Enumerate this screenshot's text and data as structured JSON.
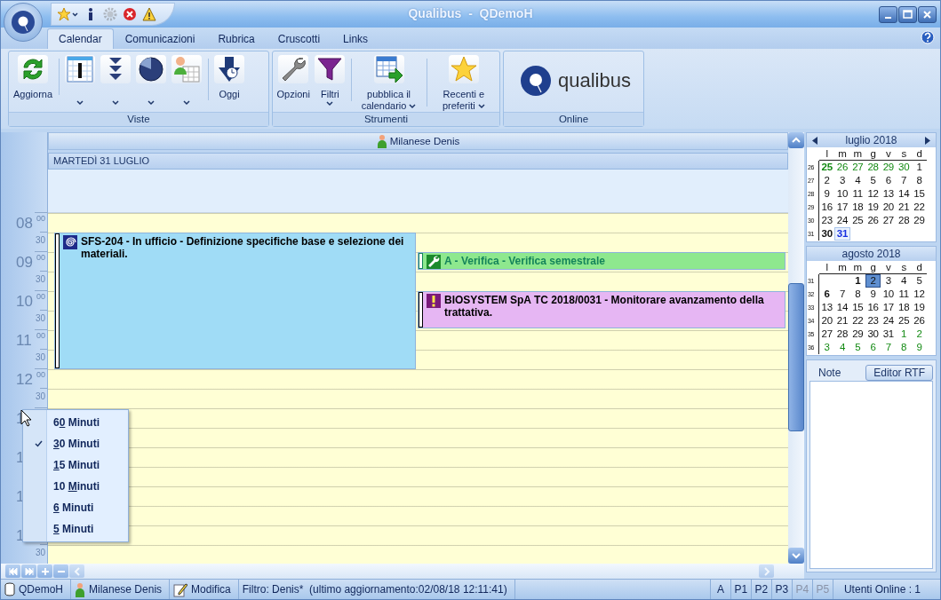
{
  "window": {
    "title": "Qualibus - QDemoH"
  },
  "quick_access": [
    {
      "kind": "star",
      "dropdown": true,
      "disabled": false
    },
    {
      "kind": "info",
      "dropdown": false,
      "disabled": false
    },
    {
      "kind": "gear",
      "dropdown": false,
      "disabled": true
    },
    {
      "kind": "close",
      "dropdown": false,
      "disabled": false
    },
    {
      "kind": "warning",
      "dropdown": false,
      "disabled": false
    }
  ],
  "tabs": [
    {
      "label": "Calendar",
      "selected": true
    },
    {
      "label": "Comunicazioni",
      "selected": false
    },
    {
      "label": "Rubrica",
      "selected": false
    },
    {
      "label": "Cruscotti",
      "selected": false
    },
    {
      "label": "Links",
      "selected": false
    }
  ],
  "ribbon_groups": [
    {
      "label": "Viste",
      "buttons": [
        {
          "kind": "refresh",
          "label": "Aggiorna",
          "dropdown": false,
          "divider_after": true
        },
        {
          "kind": "day-view",
          "dropdown": true,
          "divider_after": false
        },
        {
          "kind": "expand",
          "dropdown": true,
          "divider_after": false
        },
        {
          "kind": "pie",
          "dropdown": true,
          "divider_after": false
        },
        {
          "kind": "resource",
          "dropdown": true,
          "divider_after": true
        },
        {
          "kind": "today",
          "label": "Oggi",
          "dropdown": false,
          "divider_after": false
        }
      ]
    },
    {
      "label": "Strumenti",
      "buttons": [
        {
          "kind": "options",
          "label": "Opzioni",
          "dropdown": false,
          "divider_after": false
        },
        {
          "kind": "filter",
          "label": "Filtri",
          "dropdown": true,
          "divider_after": true
        },
        {
          "kind": "publish",
          "label": "pubblica il calendario",
          "dropdown": true,
          "divider_after": true
        },
        {
          "kind": "favorites",
          "label": "Recenti e preferiti",
          "dropdown": true,
          "divider_after": false
        }
      ]
    },
    {
      "label": "Online",
      "logo": "qualibus"
    }
  ],
  "calendar": {
    "resource": "Milanese Denis",
    "date": "MARTEDÌ 31 LUGLIO",
    "slots": [
      {
        "hour": "08",
        "minutes": "00",
        "half": "30"
      },
      {
        "hour": "09",
        "minutes": "00",
        "half": "30"
      },
      {
        "hour": "10",
        "minutes": "00",
        "half": "30"
      },
      {
        "hour": "11",
        "minutes": "00",
        "half": "30"
      },
      {
        "hour": "12",
        "minutes": "00",
        "half": "30"
      },
      {
        "hour": "1"
      },
      {
        "hour": "1"
      },
      {
        "hour": "1"
      },
      {
        "hour": "1",
        "half": "30"
      }
    ],
    "events": [
      {
        "kind": "task",
        "text": "SFS-204 - In ufficio - Definizione specifiche base e selezione dei materiali.",
        "color": "#a0dcf6"
      },
      {
        "kind": "maintenance",
        "text": "A - Verifica - Verifica semestrale",
        "color": "#8ee88e"
      },
      {
        "kind": "alert",
        "text": "BIOSYSTEM SpA TC 2018/0031 - Monitorare avanzamento della trattativa.",
        "color": "#e6b6f3"
      }
    ]
  },
  "slot_menu": {
    "items": [
      {
        "pre": "6",
        "key": "0",
        "post": " Minuti",
        "checked": false
      },
      {
        "key": "3",
        "post": "0 Minuti",
        "checked": true
      },
      {
        "key": "1",
        "post": "5 Minuti",
        "checked": false
      },
      {
        "pre": "10 ",
        "key": "M",
        "post": "inuti",
        "checked": false
      },
      {
        "key": "6",
        "post": " Minuti",
        "checked": false
      },
      {
        "key": "5",
        "post": " Minuti",
        "checked": false
      }
    ]
  },
  "months": [
    {
      "title": "luglio 2018",
      "arrows": true,
      "weekdays": [
        "l",
        "m",
        "m",
        "g",
        "v",
        "s",
        "d"
      ],
      "weeks": [
        {
          "number": "26",
          "days": [
            {
              "d": "25",
              "kind": "other-bold"
            },
            {
              "d": "26",
              "kind": "other"
            },
            {
              "d": "27",
              "kind": "other"
            },
            {
              "d": "28",
              "kind": "other"
            },
            {
              "d": "29",
              "kind": "other"
            },
            {
              "d": "30",
              "kind": "other"
            },
            {
              "d": "1",
              "kind": "normal"
            }
          ]
        },
        {
          "number": "27",
          "days": [
            {
              "d": "2",
              "kind": "normal"
            },
            {
              "d": "3",
              "kind": "normal"
            },
            {
              "d": "4",
              "kind": "normal"
            },
            {
              "d": "5",
              "kind": "normal"
            },
            {
              "d": "6",
              "kind": "normal"
            },
            {
              "d": "7",
              "kind": "normal"
            },
            {
              "d": "8",
              "kind": "normal"
            }
          ]
        },
        {
          "number": "28",
          "days": [
            {
              "d": "9",
              "kind": "normal"
            },
            {
              "d": "10",
              "kind": "normal"
            },
            {
              "d": "11",
              "kind": "normal"
            },
            {
              "d": "12",
              "kind": "normal"
            },
            {
              "d": "13",
              "kind": "normal"
            },
            {
              "d": "14",
              "kind": "normal"
            },
            {
              "d": "15",
              "kind": "normal"
            }
          ]
        },
        {
          "number": "29",
          "days": [
            {
              "d": "16",
              "kind": "normal"
            },
            {
              "d": "17",
              "kind": "normal"
            },
            {
              "d": "18",
              "kind": "normal"
            },
            {
              "d": "19",
              "kind": "normal"
            },
            {
              "d": "20",
              "kind": "normal"
            },
            {
              "d": "21",
              "kind": "normal"
            },
            {
              "d": "22",
              "kind": "normal"
            }
          ]
        },
        {
          "number": "30",
          "days": [
            {
              "d": "23",
              "kind": "normal"
            },
            {
              "d": "24",
              "kind": "normal"
            },
            {
              "d": "25",
              "kind": "normal"
            },
            {
              "d": "26",
              "kind": "normal"
            },
            {
              "d": "27",
              "kind": "normal"
            },
            {
              "d": "28",
              "kind": "normal"
            },
            {
              "d": "29",
              "kind": "normal"
            }
          ]
        },
        {
          "number": "31",
          "days": [
            {
              "d": "30",
              "kind": "bold"
            },
            {
              "d": "31",
              "kind": "today"
            },
            {
              "kind": "blank"
            },
            {
              "kind": "blank"
            },
            {
              "kind": "blank"
            },
            {
              "kind": "blank"
            },
            {
              "kind": "blank"
            }
          ]
        }
      ]
    },
    {
      "title": "agosto 2018",
      "arrows": false,
      "weekdays": [
        "l",
        "m",
        "m",
        "g",
        "v",
        "s",
        "d"
      ],
      "weeks": [
        {
          "number": "31",
          "days": [
            {
              "kind": "blank"
            },
            {
              "kind": "blank"
            },
            {
              "d": "1",
              "kind": "bold"
            },
            {
              "d": "2",
              "kind": "selected"
            },
            {
              "d": "3",
              "kind": "normal"
            },
            {
              "d": "4",
              "kind": "normal"
            },
            {
              "d": "5",
              "kind": "normal"
            }
          ]
        },
        {
          "number": "32",
          "days": [
            {
              "d": "6",
              "kind": "bold"
            },
            {
              "d": "7",
              "kind": "normal"
            },
            {
              "d": "8",
              "kind": "normal"
            },
            {
              "d": "9",
              "kind": "normal"
            },
            {
              "d": "10",
              "kind": "normal"
            },
            {
              "d": "11",
              "kind": "normal"
            },
            {
              "d": "12",
              "kind": "normal"
            }
          ]
        },
        {
          "number": "33",
          "days": [
            {
              "d": "13",
              "kind": "normal"
            },
            {
              "d": "14",
              "kind": "normal"
            },
            {
              "d": "15",
              "kind": "normal"
            },
            {
              "d": "16",
              "kind": "normal"
            },
            {
              "d": "17",
              "kind": "normal"
            },
            {
              "d": "18",
              "kind": "normal"
            },
            {
              "d": "19",
              "kind": "normal"
            }
          ]
        },
        {
          "number": "34",
          "days": [
            {
              "d": "20",
              "kind": "normal"
            },
            {
              "d": "21",
              "kind": "normal"
            },
            {
              "d": "22",
              "kind": "normal"
            },
            {
              "d": "23",
              "kind": "normal"
            },
            {
              "d": "24",
              "kind": "normal"
            },
            {
              "d": "25",
              "kind": "normal"
            },
            {
              "d": "26",
              "kind": "normal"
            }
          ]
        },
        {
          "number": "35",
          "days": [
            {
              "d": "27",
              "kind": "normal"
            },
            {
              "d": "28",
              "kind": "normal"
            },
            {
              "d": "29",
              "kind": "normal"
            },
            {
              "d": "30",
              "kind": "normal"
            },
            {
              "d": "31",
              "kind": "normal"
            },
            {
              "d": "1",
              "kind": "other"
            },
            {
              "d": "2",
              "kind": "other"
            }
          ]
        },
        {
          "number": "36",
          "days": [
            {
              "d": "3",
              "kind": "other"
            },
            {
              "d": "4",
              "kind": "other"
            },
            {
              "d": "5",
              "kind": "other"
            },
            {
              "d": "6",
              "kind": "other"
            },
            {
              "d": "7",
              "kind": "other"
            },
            {
              "d": "8",
              "kind": "other"
            },
            {
              "d": "9",
              "kind": "other"
            }
          ]
        }
      ]
    }
  ],
  "notes": {
    "tab": "Note",
    "button": "Editor RTF"
  },
  "status_bar": {
    "items": [
      {
        "kind": "database",
        "text": "QDemoH"
      },
      {
        "kind": "user",
        "text": "Milanese Denis"
      },
      {
        "kind": "edit",
        "text": "Modifica"
      },
      {
        "kind": "plain",
        "text": "Filtro: Denis*  (ultimo aggiornamento:02/08/18 12:11:41)"
      }
    ],
    "flags": [
      {
        "label": "A",
        "disabled": false
      },
      {
        "label": "P1",
        "disabled": false
      },
      {
        "label": "P2",
        "disabled": false
      },
      {
        "label": "P3",
        "disabled": false
      },
      {
        "label": "P4",
        "disabled": true
      },
      {
        "label": "P5",
        "disabled": true
      }
    ],
    "online": "Utenti Online : 1"
  }
}
